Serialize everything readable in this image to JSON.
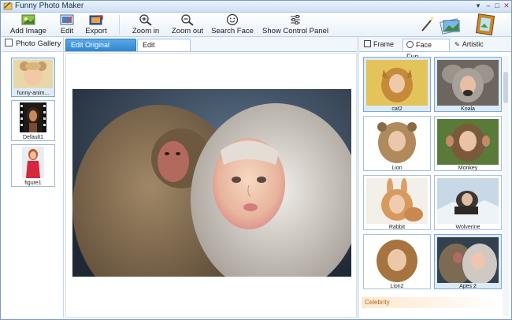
{
  "app": {
    "title": "Funny Photo Maker"
  },
  "window_controls": {
    "menu": "▾",
    "minimize": "–",
    "maximize": "□",
    "close": "✕"
  },
  "toolbar": {
    "add_image": "Add Image",
    "edit": "Edit",
    "export": "Export",
    "zoom_in": "Zoom in",
    "zoom_out": "Zoom out",
    "search_face": "Search Face",
    "show_control_panel": "Show Control Panel"
  },
  "gallery": {
    "header": "Photo Gallery",
    "items": [
      {
        "label": "funny-anim..."
      },
      {
        "label": "Default1"
      },
      {
        "label": "figure1"
      }
    ]
  },
  "editor": {
    "tabs": [
      {
        "label": "Edit Original Image",
        "active": true
      },
      {
        "label": "Edit Template",
        "active": false
      }
    ]
  },
  "right_panel": {
    "tabs": [
      {
        "label": "Frame"
      },
      {
        "label": "Face Fun",
        "selected": true
      },
      {
        "label": "Artistic"
      }
    ],
    "templates": [
      {
        "label": "cat2"
      },
      {
        "label": "Koala"
      },
      {
        "label": "Lion"
      },
      {
        "label": "Monkey"
      },
      {
        "label": "Rabbit"
      },
      {
        "label": "Wolverine"
      },
      {
        "label": "Lion2"
      },
      {
        "label": "Apes 2"
      }
    ],
    "section_label": "Celebrity"
  },
  "colors": {
    "accent": "#2f86cf",
    "tab_border": "#aac4e3",
    "section": "#b5651d"
  }
}
